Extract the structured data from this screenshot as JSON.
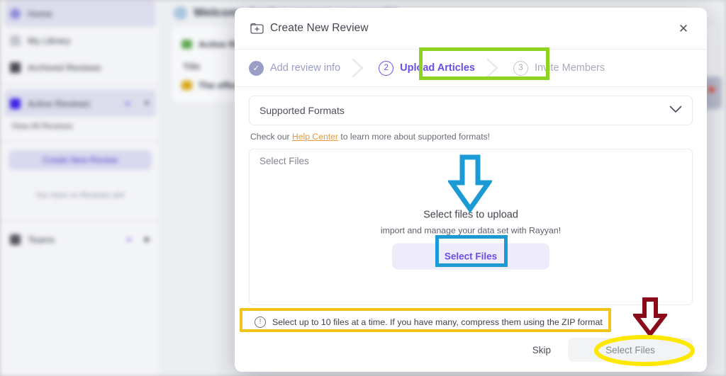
{
  "background": {
    "sidebar": {
      "items": [
        {
          "label": "Home",
          "icon": "home-icon",
          "active": true
        },
        {
          "label": "My Library",
          "icon": "library-icon",
          "active": false
        },
        {
          "label": "Archived Reviews",
          "icon": "archive-icon",
          "active": false
        },
        {
          "label": "Active Reviews",
          "icon": "folder-icon",
          "active": true
        }
      ],
      "view_all_label": "View All Reviews",
      "create_button_label": "Create New Review",
      "empty_text": "You have no Reviews yet!",
      "teams_label": "Teams",
      "add_icon": "plus-icon",
      "expand_icon": "chevron-down-icon"
    },
    "main": {
      "welcome": "Welcome back a.sarwup sonnanah!",
      "active_reviews_label": "Active Re",
      "column_title": "Title",
      "review_row": "The effect"
    }
  },
  "modal": {
    "title": "Create New Review",
    "title_icon": "folder-plus-icon",
    "close_icon": "close-icon",
    "steps": [
      {
        "num": "✓",
        "label": "Add review info",
        "state": "done"
      },
      {
        "num": "2",
        "label": "Upload Articles",
        "state": "current"
      },
      {
        "num": "3",
        "label": "Invite Members",
        "state": "todo"
      }
    ],
    "accordion": {
      "label": "Supported Formats",
      "chevron_icon": "chevron-down-icon"
    },
    "help_line": {
      "prefix": "Check our ",
      "link": "Help Center",
      "suffix": " to learn more about supported formats!"
    },
    "dropzone": {
      "label": "Select Files",
      "headline": "Select files to upload",
      "subtext": "import and manage your data set with Rayyan!",
      "button_label": "Select Files"
    },
    "footer": {
      "info_icon": "info-circle-icon",
      "info_text": "Select up to 10 files at a time. If you have many, compress them using the ZIP format",
      "skip_label": "Skip",
      "primary_label": "Select Files"
    }
  },
  "annotations": [
    {
      "name": "green-box-upload-articles",
      "shape": "rectangle",
      "color": "#8ED321",
      "target": "Upload Articles step"
    },
    {
      "name": "blue-arrow-dropzone",
      "shape": "down-arrow",
      "color": "#1C9AD6",
      "target": "Select files to upload"
    },
    {
      "name": "blue-box-select-files",
      "shape": "rectangle",
      "color": "#1C9AD6",
      "target": "Select Files dropzone button"
    },
    {
      "name": "yellow-box-info",
      "shape": "rectangle",
      "color": "#F3C218",
      "target": "file limit info text"
    },
    {
      "name": "red-arrow-primary",
      "shape": "down-arrow",
      "color": "#8B0A1A",
      "target": "Select Files footer button"
    },
    {
      "name": "yellow-ellipse-primary",
      "shape": "ellipse",
      "color": "#FFE800",
      "target": "Select Files footer button"
    }
  ],
  "colors": {
    "accent_purple": "#6B4DE6",
    "link_orange": "#E79A3C",
    "anno_green": "#8ED321",
    "anno_blue": "#1C9AD6",
    "anno_yellow": "#F3C218",
    "anno_red": "#8B0A1A",
    "anno_yellow_bright": "#FFE800"
  }
}
